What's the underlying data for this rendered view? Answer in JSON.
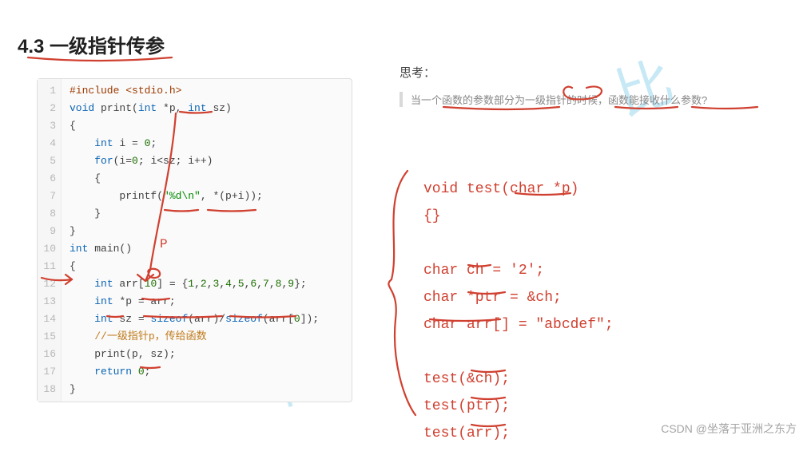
{
  "title": "4.3 一级指针传参",
  "code": {
    "lines": [
      [
        {
          "t": "#include <stdio.h>",
          "c": "pp"
        }
      ],
      [
        {
          "t": "void",
          "c": "kw"
        },
        {
          "t": " print("
        },
        {
          "t": "int",
          "c": "kw"
        },
        {
          "t": " *p, "
        },
        {
          "t": "int",
          "c": "kw"
        },
        {
          "t": " sz)"
        }
      ],
      [
        {
          "t": "{"
        }
      ],
      [
        {
          "t": "    "
        },
        {
          "t": "int",
          "c": "kw"
        },
        {
          "t": " i = "
        },
        {
          "t": "0",
          "c": "num"
        },
        {
          "t": ";"
        }
      ],
      [
        {
          "t": "    "
        },
        {
          "t": "for",
          "c": "kw"
        },
        {
          "t": "(i="
        },
        {
          "t": "0",
          "c": "num"
        },
        {
          "t": "; i<sz; i++)"
        }
      ],
      [
        {
          "t": "    {"
        }
      ],
      [
        {
          "t": "        printf("
        },
        {
          "t": "\"%d\\n\"",
          "c": "str"
        },
        {
          "t": ", *(p+i));"
        }
      ],
      [
        {
          "t": "    }"
        }
      ],
      [
        {
          "t": "}"
        }
      ],
      [
        {
          "t": "int",
          "c": "kw"
        },
        {
          "t": " main()"
        }
      ],
      [
        {
          "t": "{"
        }
      ],
      [
        {
          "t": "    "
        },
        {
          "t": "int",
          "c": "kw"
        },
        {
          "t": " arr["
        },
        {
          "t": "10",
          "c": "num"
        },
        {
          "t": "] = {"
        },
        {
          "t": "1",
          "c": "num"
        },
        {
          "t": ","
        },
        {
          "t": "2",
          "c": "num"
        },
        {
          "t": ","
        },
        {
          "t": "3",
          "c": "num"
        },
        {
          "t": ","
        },
        {
          "t": "4",
          "c": "num"
        },
        {
          "t": ","
        },
        {
          "t": "5",
          "c": "num"
        },
        {
          "t": ","
        },
        {
          "t": "6",
          "c": "num"
        },
        {
          "t": ","
        },
        {
          "t": "7",
          "c": "num"
        },
        {
          "t": ","
        },
        {
          "t": "8",
          "c": "num"
        },
        {
          "t": ","
        },
        {
          "t": "9",
          "c": "num"
        },
        {
          "t": "};"
        }
      ],
      [
        {
          "t": "    "
        },
        {
          "t": "int",
          "c": "kw"
        },
        {
          "t": " *p = arr;"
        }
      ],
      [
        {
          "t": "    "
        },
        {
          "t": "int",
          "c": "kw"
        },
        {
          "t": " sz = "
        },
        {
          "t": "sizeof",
          "c": "kw"
        },
        {
          "t": "(arr)/"
        },
        {
          "t": "sizeof",
          "c": "kw"
        },
        {
          "t": "(arr["
        },
        {
          "t": "0",
          "c": "num"
        },
        {
          "t": "]);"
        }
      ],
      [
        {
          "t": "    "
        },
        {
          "t": "//一级指针p，传给函数",
          "c": "cmt"
        }
      ],
      [
        {
          "t": "    print(p, sz);"
        }
      ],
      [
        {
          "t": "    "
        },
        {
          "t": "return",
          "c": "kw"
        },
        {
          "t": " "
        },
        {
          "t": "0",
          "c": "num"
        },
        {
          "t": ";"
        }
      ],
      [
        {
          "t": "}"
        }
      ]
    ]
  },
  "think": {
    "label": "思考：",
    "quote": "当一个函数的参数部分为一级指针的时候，函数能接收什么参数?"
  },
  "handwriting": [
    "void test(char *p)",
    "{}",
    "",
    "char ch = '2';",
    "char *ptr = &ch;",
    "char arr[] = \"abcdef\";",
    "",
    "test(&ch);",
    "test(ptr);",
    "test(arr);"
  ],
  "watermark": "CSDN @坐落于亚洲之东方",
  "blue_watermarks": [
    "比",
    "特"
  ]
}
